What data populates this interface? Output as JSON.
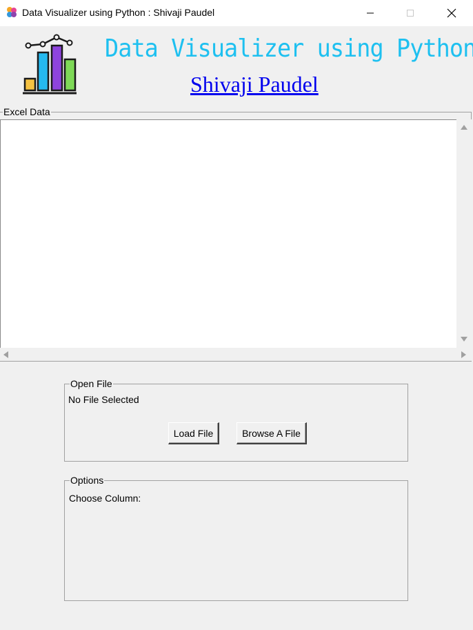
{
  "window": {
    "title": "Data Visualizer using Python : Shivaji Paudel",
    "controls": [
      "minimize",
      "maximize",
      "close"
    ]
  },
  "header": {
    "heading": "Data Visualizer using Python",
    "author": "Shivaji Paudel",
    "heading_color": "#1ec0f0",
    "author_color": "#0000ee"
  },
  "excel_frame": {
    "label": "Excel Data"
  },
  "open_file": {
    "label": "Open File",
    "status": "No File Selected",
    "load_button": "Load File",
    "browse_button": "Browse A File"
  },
  "options": {
    "label": "Options",
    "choose_column": "Choose Column:"
  },
  "icons": {
    "app": "color-blob-icon",
    "logo": "bar-chart-icon"
  }
}
